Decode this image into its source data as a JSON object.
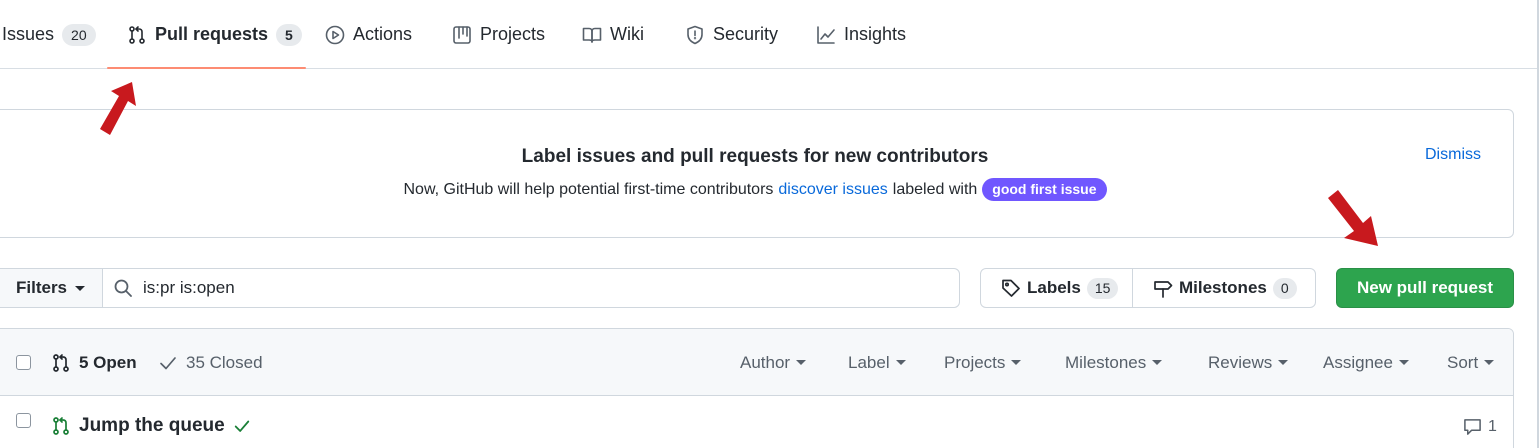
{
  "tabs": [
    {
      "label": "Issues",
      "count": "20"
    },
    {
      "label": "Pull requests",
      "count": "5"
    },
    {
      "label": "Actions"
    },
    {
      "label": "Projects"
    },
    {
      "label": "Wiki"
    },
    {
      "label": "Security"
    },
    {
      "label": "Insights"
    }
  ],
  "banner": {
    "title": "Label issues and pull requests for new contributors",
    "text_before": "Now, GitHub will help potential first-time contributors",
    "link": "discover issues",
    "text_after": "labeled with",
    "label": "good first issue",
    "dismiss": "Dismiss"
  },
  "filters": {
    "button": "Filters",
    "search_value": "is:pr is:open",
    "labels": "Labels",
    "labels_count": "15",
    "milestones": "Milestones",
    "milestones_count": "0",
    "new_pr": "New pull request"
  },
  "list": {
    "open": "5 Open",
    "closed": "35 Closed",
    "filters": [
      "Author",
      "Label",
      "Projects",
      "Milestones",
      "Reviews",
      "Assignee",
      "Sort"
    ],
    "rows": [
      {
        "title": "Jump the queue",
        "comments": "1"
      }
    ]
  },
  "colors": {
    "accent_green": "#2da44e",
    "link_blue": "#0969da",
    "label_purple": "#7057ff",
    "tab_underline": "#fd8c73",
    "annotation_red": "#c8191e"
  }
}
